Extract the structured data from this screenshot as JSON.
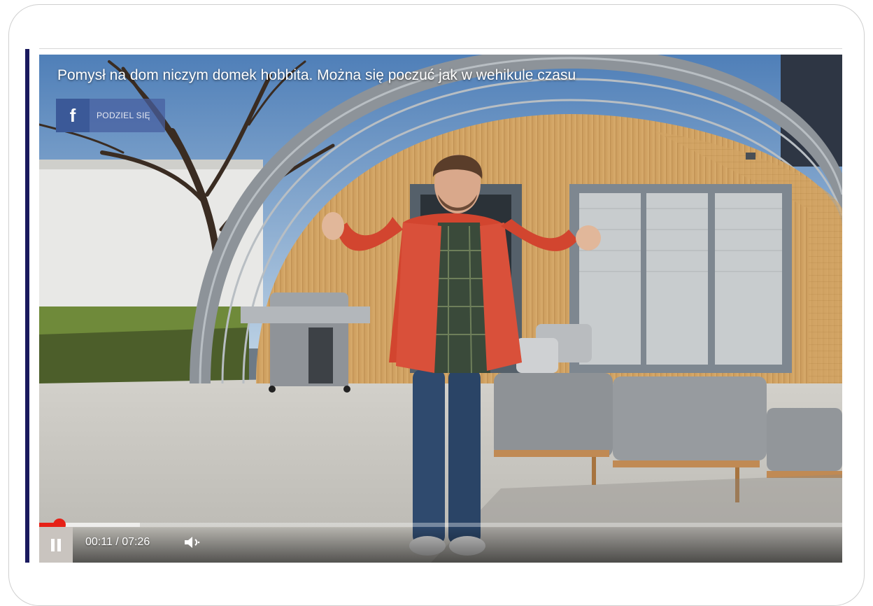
{
  "video": {
    "title": "Pomysł na dom niczym domek hobbita. Można się poczuć jak w wehikule czasu",
    "share_label": "PODZIEL SIĘ",
    "share_icon": "facebook-icon",
    "time_display": "00:11 / 07:26",
    "current_time": "00:11",
    "duration": "07:26",
    "played_fraction": 0.025,
    "buffered_fraction": 0.125,
    "state": "playing"
  },
  "controls": {
    "pause_icon": "pause-icon",
    "volume_icon": "volume-icon"
  },
  "colors": {
    "accent_bar": "#1a1a5e",
    "progress_played": "#e62117",
    "facebook": "#3b5998"
  }
}
